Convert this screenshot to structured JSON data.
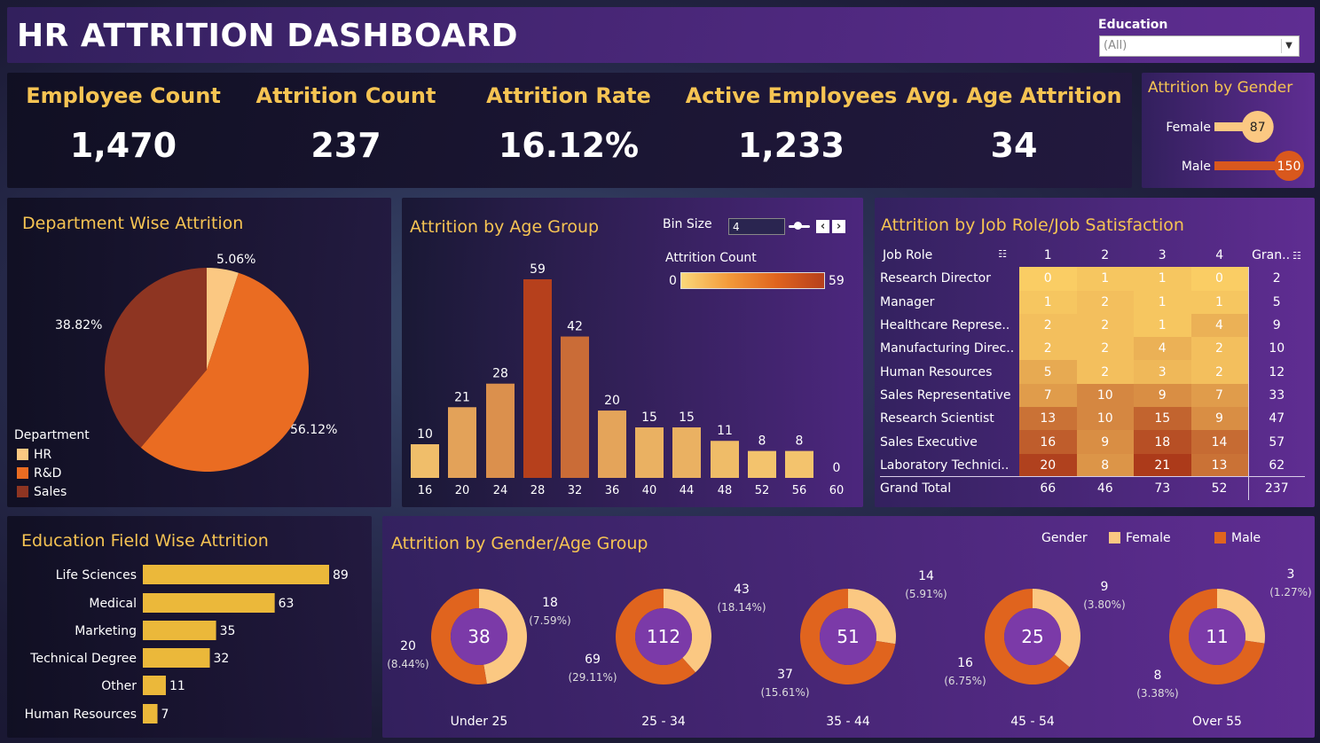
{
  "header": {
    "title": "HR ATTRITION DASHBOARD",
    "filter_label": "Education",
    "filter_value": "(All)"
  },
  "kpis": [
    {
      "label": "Employee Count",
      "value": "1,470"
    },
    {
      "label": "Attrition Count",
      "value": "237"
    },
    {
      "label": "Attrition Rate",
      "value": "16.12%"
    },
    {
      "label": "Active Employees",
      "value": "1,233"
    },
    {
      "label": "Avg. Age Attrition",
      "value": "34"
    }
  ],
  "colors": {
    "gold": "#f6c453",
    "light_orange": "#fbc882",
    "orange": "#ea6c22",
    "dark_orange": "#b8461f",
    "dark_red": "#8e3522",
    "bar_yellow": "#ebb83a",
    "purple_center": "#7b3aa8"
  },
  "chart_data": [
    {
      "type": "lollipop",
      "title": "Attrition by Gender",
      "categories": [
        "Female",
        "Male"
      ],
      "values": [
        87,
        150
      ],
      "labels": [
        "87",
        "150"
      ],
      "xlim": [
        0,
        150
      ]
    },
    {
      "type": "pie",
      "title": "Department Wise Attrition",
      "legend_title": "Department",
      "legend": [
        "HR",
        "R&D",
        "Sales"
      ],
      "values": [
        5.06,
        56.12,
        38.82
      ],
      "labels": [
        "5.06%",
        "56.12%",
        "38.82%"
      ],
      "colors": [
        "#fbc882",
        "#ea6c22",
        "#8e3522"
      ]
    },
    {
      "type": "bar",
      "title": "Attrition by Age Group",
      "controls": {
        "bin_label": "Bin Size",
        "bin_value": "4",
        "legend_title": "Attrition Count",
        "legend_min": "0",
        "legend_max": "59"
      },
      "categories": [
        "16",
        "20",
        "24",
        "28",
        "32",
        "36",
        "40",
        "44",
        "48",
        "52",
        "56",
        "60"
      ],
      "values": [
        10,
        21,
        28,
        59,
        42,
        20,
        15,
        15,
        11,
        8,
        8,
        0
      ],
      "labels": [
        "10",
        "21",
        "28",
        "59",
        "42",
        "20",
        "15",
        "15",
        "11",
        "8",
        "8",
        "0"
      ],
      "ylim": [
        0,
        59
      ]
    },
    {
      "type": "heatmap",
      "title": "Attrition by Job Role/Job Satisfaction",
      "row_header": "Job Role",
      "columns": [
        "1",
        "2",
        "3",
        "4"
      ],
      "total_header": "Gran..",
      "rows": [
        {
          "label": "Research Director",
          "values": [
            0,
            1,
            1,
            0
          ],
          "total": 2
        },
        {
          "label": "Manager",
          "values": [
            1,
            2,
            1,
            1
          ],
          "total": 5
        },
        {
          "label": "Healthcare Represe..",
          "values": [
            2,
            2,
            1,
            4
          ],
          "total": 9
        },
        {
          "label": "Manufacturing Direc..",
          "values": [
            2,
            2,
            4,
            2
          ],
          "total": 10
        },
        {
          "label": "Human Resources",
          "values": [
            5,
            2,
            3,
            2
          ],
          "total": 12
        },
        {
          "label": "Sales Representative",
          "values": [
            7,
            10,
            9,
            7
          ],
          "total": 33
        },
        {
          "label": "Research Scientist",
          "values": [
            13,
            10,
            15,
            9
          ],
          "total": 47
        },
        {
          "label": "Sales Executive",
          "values": [
            16,
            9,
            18,
            14
          ],
          "total": 57
        },
        {
          "label": "Laboratory Technici..",
          "values": [
            20,
            8,
            21,
            13
          ],
          "total": 62
        }
      ],
      "grand_total": {
        "label": "Grand Total",
        "values": [
          66,
          46,
          73,
          52
        ],
        "total": 237
      }
    },
    {
      "type": "bar",
      "title": "Education Field Wise Attrition",
      "orientation": "horizontal",
      "categories": [
        "Life Sciences",
        "Medical",
        "Marketing",
        "Technical Degree",
        "Other",
        "Human Resources"
      ],
      "values": [
        89,
        63,
        35,
        32,
        11,
        7
      ],
      "labels": [
        "89",
        "63",
        "35",
        "32",
        "11",
        "7"
      ],
      "xlim": [
        0,
        89
      ]
    },
    {
      "type": "donut",
      "title": "Attrition by Gender/Age Group",
      "legend_title": "Gender",
      "series": [
        "Female",
        "Male"
      ],
      "groups": [
        {
          "label": "Under 25",
          "total": "38",
          "female": 18,
          "female_pct": "(7.59%)",
          "male": 20,
          "male_pct": "(8.44%)"
        },
        {
          "label": "25 - 34",
          "total": "112",
          "female": 43,
          "female_pct": "(18.14%)",
          "male": 69,
          "male_pct": "(29.11%)"
        },
        {
          "label": "35 - 44",
          "total": "51",
          "female": 14,
          "female_pct": "(5.91%)",
          "male": 37,
          "male_pct": "(15.61%)"
        },
        {
          "label": "45 - 54",
          "total": "25",
          "female": 9,
          "female_pct": "(3.80%)",
          "male": 16,
          "male_pct": "(6.75%)"
        },
        {
          "label": "Over 55",
          "total": "11",
          "female": 3,
          "female_pct": "(1.27%)",
          "male": 8,
          "male_pct": "(3.38%)"
        }
      ]
    }
  ]
}
